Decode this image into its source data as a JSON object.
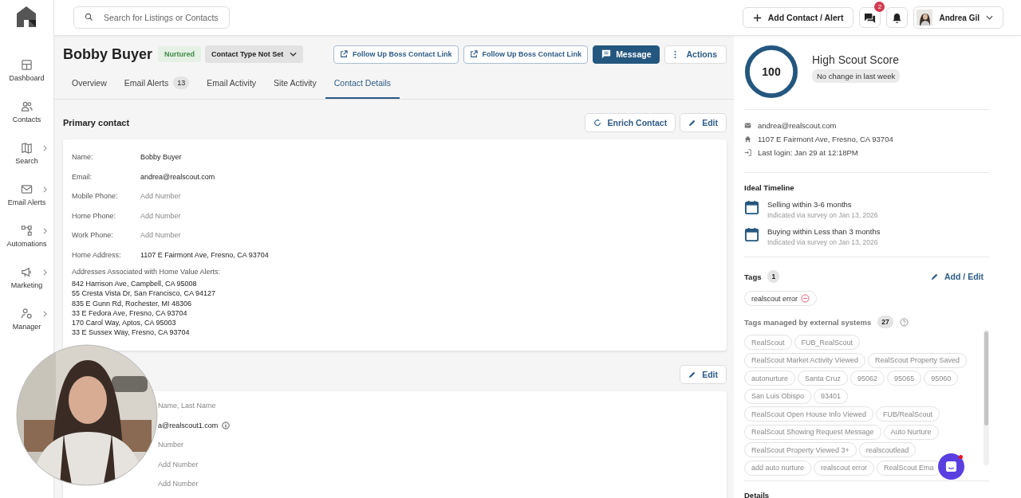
{
  "sidebar": {
    "items": [
      {
        "label": "Dashboard",
        "has_submenu": false
      },
      {
        "label": "Contacts",
        "has_submenu": false
      },
      {
        "label": "Search",
        "has_submenu": true
      },
      {
        "label": "Email Alerts",
        "has_submenu": true
      },
      {
        "label": "Automations",
        "has_submenu": true
      },
      {
        "label": "Marketing",
        "has_submenu": true
      },
      {
        "label": "Manager",
        "has_submenu": true
      }
    ]
  },
  "search": {
    "placeholder": "Search for Listings or Contacts"
  },
  "topbar": {
    "add_button": "Add Contact / Alert",
    "messages_badge": "2",
    "user": "Andrea Gil"
  },
  "contact": {
    "name": "Bobby Buyer",
    "status": "Nurtured",
    "type": "Contact Type Not Set"
  },
  "header_buttons": [
    {
      "label": "Follow Up Boss Contact Link",
      "kind": "link"
    },
    {
      "label": "Follow Up Boss Contact Link",
      "kind": "link"
    },
    {
      "label": "Message",
      "kind": "primary"
    },
    {
      "label": "Actions",
      "kind": "menu"
    }
  ],
  "tabs": [
    {
      "label": "Overview",
      "selected": false
    },
    {
      "label": "Email Alerts",
      "count": "13",
      "selected": false
    },
    {
      "label": "Email Activity",
      "selected": false
    },
    {
      "label": "Site Activity",
      "selected": false
    },
    {
      "label": "Contact Details",
      "selected": true
    }
  ],
  "primary": {
    "title": "Primary contact",
    "enrich": "Enrich Contact",
    "edit": "Edit",
    "fields": [
      {
        "label": "Name:",
        "value": "Bobby Buyer",
        "empty": false
      },
      {
        "label": "Email:",
        "value": "andrea@realscout.com",
        "empty": false
      },
      {
        "label": "Mobile Phone:",
        "value": "Add Number",
        "empty": true
      },
      {
        "label": "Home Phone:",
        "value": "Add Number",
        "empty": true
      },
      {
        "label": "Work Phone:",
        "value": "Add Number",
        "empty": true
      },
      {
        "label": "Home Address:",
        "value": "1107 E Fairmont Ave, Fresno, CA 93704",
        "empty": false
      }
    ],
    "addresses_label": "Addresses Associated with Home Value Alerts:",
    "addresses": [
      "842 Harrison Ave, Campbell, CA 95008",
      "55 Cresta Vista Dr, San Francisco, CA 94127",
      "835 E Gunn Rd, Rochester, MI 48306",
      "33 E Fedora Ave, Fresno, CA 93704",
      "170 Carol Way, Aptos, CA 95003",
      "33 E Sussex Way, Fresno, CA 93704"
    ]
  },
  "secondary": {
    "edit": "Edit",
    "values": [
      {
        "text": "Name, Last Name",
        "empty": true,
        "info": false
      },
      {
        "text": "a@realscout1.com",
        "empty": false,
        "info": true
      },
      {
        "text": "Number",
        "empty": true,
        "info": false
      },
      {
        "text": "Add Number",
        "empty": true,
        "info": false
      },
      {
        "text": "Add Number",
        "empty": true,
        "info": false
      }
    ]
  },
  "score": {
    "value": "100",
    "label": "High Scout Score",
    "change": "No change in last week"
  },
  "info": [
    {
      "kind": "email",
      "text": "andrea@realscout.com"
    },
    {
      "kind": "home",
      "text": "1107 E Fairmont Ave, Fresno, CA 93704"
    },
    {
      "kind": "login",
      "text": "Last login: Jan 29 at 12:18PM"
    }
  ],
  "timeline": {
    "title": "Ideal Timeline",
    "items": [
      {
        "title": "Selling within 3-6 months",
        "note": "Indicated via survey on Jan 13, 2026"
      },
      {
        "title": "Buying within Less than 3 months",
        "note": "Indicated via survey on Jan 13, 2026"
      }
    ]
  },
  "tags": {
    "title": "Tags",
    "count": "1",
    "action": "Add / Edit",
    "items": [
      "realscout error"
    ]
  },
  "external_tags": {
    "title": "Tags managed by external systems",
    "count": "27",
    "items": [
      "RealScout",
      "FUB_RealScout",
      "RealScout Market Activity Viewed",
      "RealScout Property Saved",
      "autonurture",
      "Santa Cruz",
      "95062",
      "95065",
      "95060",
      "San Luis Obispo",
      "93401",
      "RealScout Open House Info Viewed",
      "FUB/RealScout",
      "RealScout Showing Request Message",
      "Auto Nurture",
      "RealScout Property Viewed 3+",
      "realscoutlead",
      "add auto nurture",
      "realscout error",
      "RealScout Ema"
    ]
  },
  "details": {
    "title": "Details"
  }
}
